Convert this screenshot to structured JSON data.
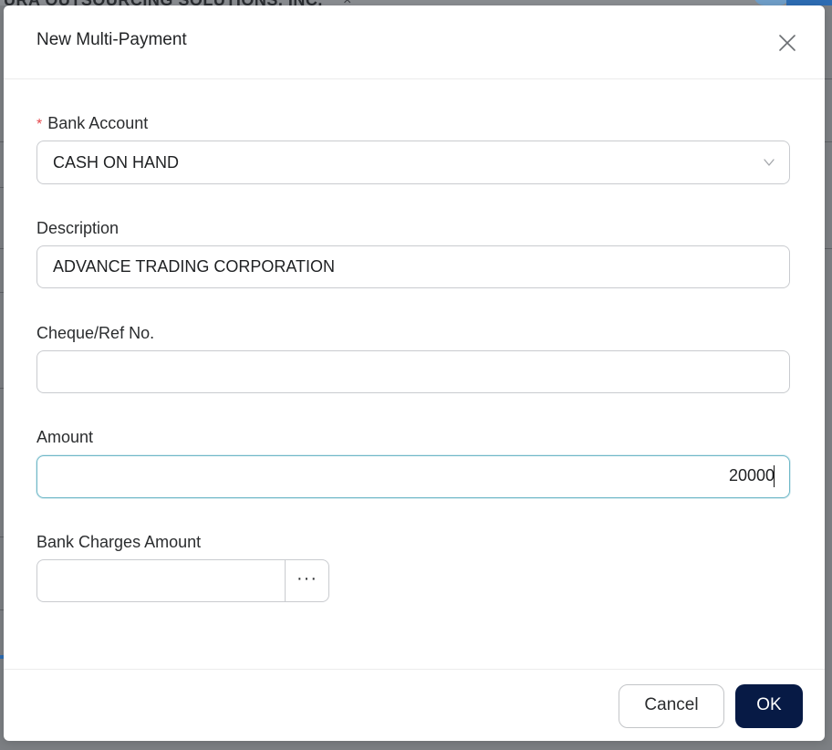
{
  "background": {
    "title_fragment": "URA OUTSOURCING SOLUTIONS, INC.",
    "close_glyph": "×"
  },
  "dialog": {
    "title": "New Multi-Payment",
    "close_icon": "close-icon"
  },
  "fields": {
    "bank_account": {
      "label": "Bank Account",
      "required_mark": "*",
      "value": "CASH ON HAND",
      "icon": "chevron-down-icon"
    },
    "description": {
      "label": "Description",
      "value": "ADVANCE TRADING CORPORATION"
    },
    "cheque_ref": {
      "label": "Cheque/Ref No.",
      "value": ""
    },
    "amount": {
      "label": "Amount",
      "value": "20000"
    },
    "bank_charges": {
      "label": "Bank Charges Amount",
      "value": "",
      "lookup_label": "···"
    }
  },
  "footer": {
    "cancel_label": "Cancel",
    "ok_label": "OK"
  },
  "colors": {
    "primary_button": "#071a45",
    "focus_border": "#6fb8c8",
    "required": "#e5484d"
  }
}
